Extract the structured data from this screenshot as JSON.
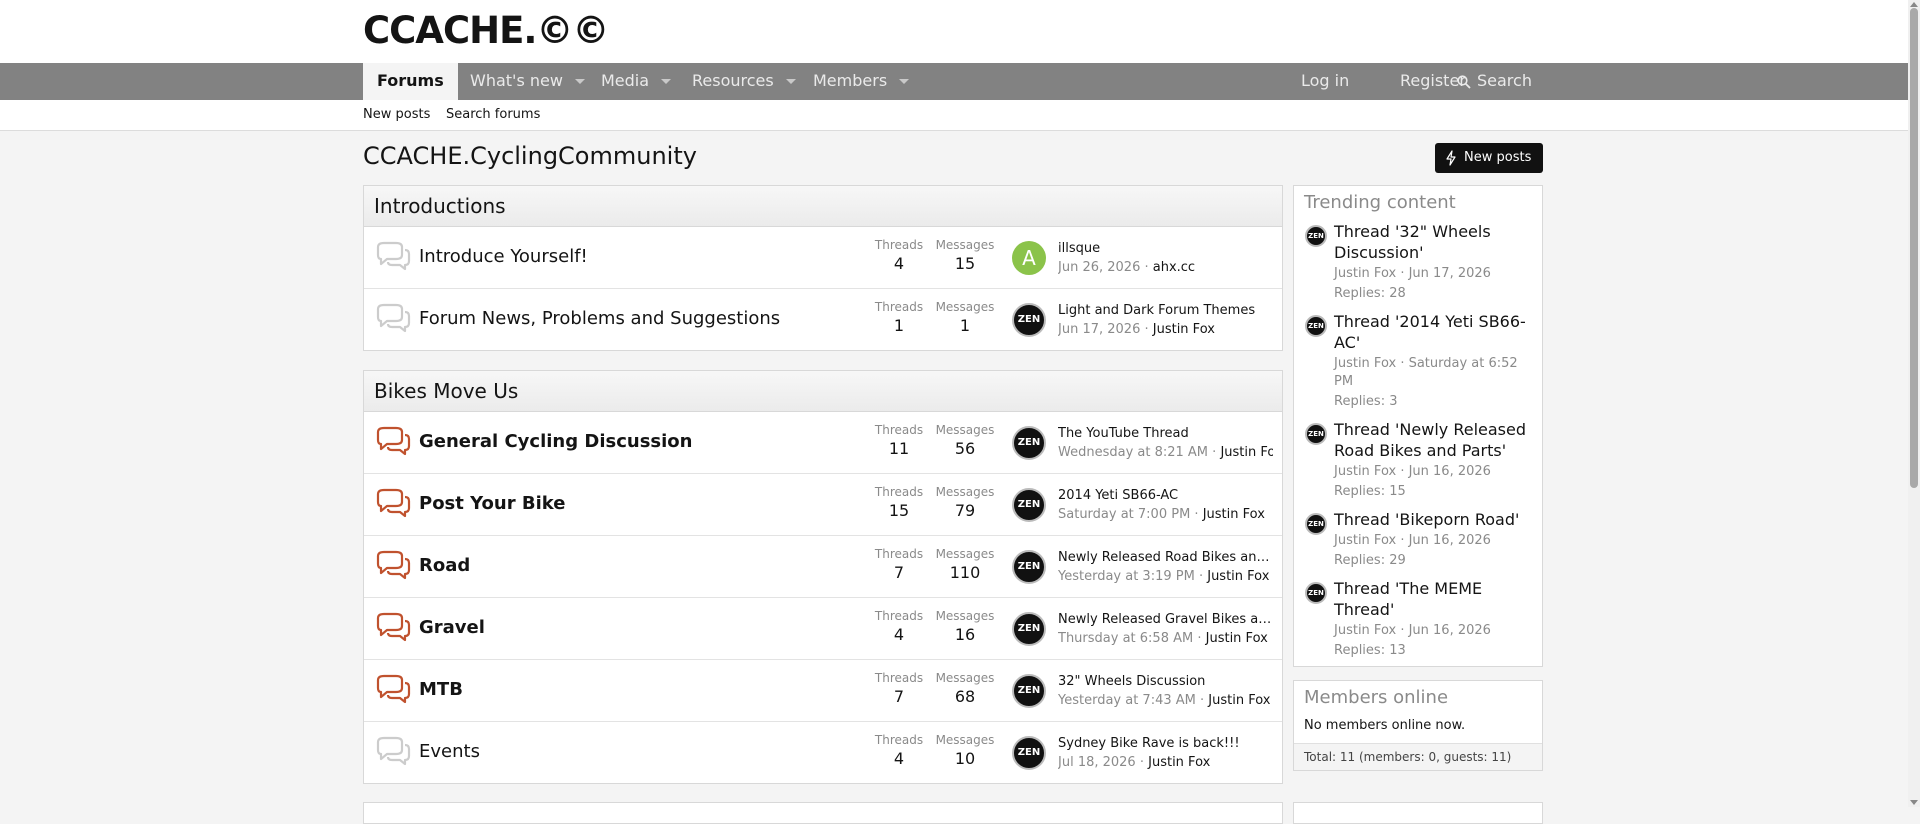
{
  "logo": "CCACHE.©©",
  "nav": {
    "forums": "Forums",
    "whats_new": "What's new",
    "media": "Media",
    "resources": "Resources",
    "members": "Members",
    "login": "Log in",
    "register": "Register",
    "search": "Search"
  },
  "subnav": {
    "new_posts": "New posts",
    "search_forums": "Search forums"
  },
  "page_title": "CCACHE.CyclingCommunity",
  "new_posts_button": "New posts",
  "labels": {
    "threads": "Threads",
    "messages": "Messages"
  },
  "categories": [
    {
      "title": "Introductions",
      "nodes": [
        {
          "title": "Introduce Yourself!",
          "threads": "4",
          "messages": "15",
          "avatar": "A",
          "latest_title": "illsque",
          "latest_date": "Jun 26, 2026",
          "latest_user": "ahx.cc"
        },
        {
          "title": "Forum News, Problems and Suggestions",
          "threads": "1",
          "messages": "1",
          "avatar": "ZEN",
          "latest_title": "Light and Dark Forum Themes",
          "latest_date": "Jun 17, 2026",
          "latest_user": "Justin Fox"
        }
      ]
    },
    {
      "title": "Bikes Move Us",
      "nodes": [
        {
          "title": "General Cycling Discussion",
          "threads": "11",
          "messages": "56",
          "avatar": "ZEN",
          "latest_title": "The YouTube Thread",
          "latest_date": "Wednesday at 8:21 AM",
          "latest_user": "Justin Fox"
        },
        {
          "title": "Post Your Bike",
          "threads": "15",
          "messages": "79",
          "avatar": "ZEN",
          "latest_title": "2014 Yeti SB66-AC",
          "latest_date": "Saturday at 7:00 PM",
          "latest_user": "Justin Fox"
        },
        {
          "title": "Road",
          "threads": "7",
          "messages": "110",
          "avatar": "ZEN",
          "latest_title": "Newly Released Road Bikes and Parts",
          "latest_date": "Yesterday at 3:19 PM",
          "latest_user": "Justin Fox"
        },
        {
          "title": "Gravel",
          "threads": "4",
          "messages": "16",
          "avatar": "ZEN",
          "latest_title": "Newly Released Gravel Bikes and Parts",
          "latest_date": "Thursday at 6:58 AM",
          "latest_user": "Justin Fox"
        },
        {
          "title": "MTB",
          "threads": "7",
          "messages": "68",
          "avatar": "ZEN",
          "latest_title": "32\" Wheels Discussion",
          "latest_date": "Yesterday at 7:43 AM",
          "latest_user": "Justin Fox"
        },
        {
          "title": "Events",
          "threads": "4",
          "messages": "10",
          "avatar": "ZEN",
          "latest_title": "Sydney Bike Rave is back!!!",
          "latest_date": "Jul 18, 2026",
          "latest_user": "Justin Fox"
        }
      ]
    }
  ],
  "trending": {
    "title": "Trending content",
    "items": [
      {
        "title": "Thread '32\" Wheels Discussion'",
        "meta": "Justin Fox · Jun 17, 2026",
        "replies": "Replies: 28"
      },
      {
        "title": "Thread '2014 Yeti SB66-AC'",
        "meta": "Justin Fox · Saturday at 6:52 PM",
        "replies": "Replies: 3"
      },
      {
        "title": "Thread 'Newly Released Road Bikes and Parts'",
        "meta": "Justin Fox · Jun 16, 2026",
        "replies": "Replies: 15"
      },
      {
        "title": "Thread 'Bikeporn Road'",
        "meta": "Justin Fox · Jun 16, 2026",
        "replies": "Replies: 29"
      },
      {
        "title": "Thread 'The MEME Thread'",
        "meta": "Justin Fox · Jun 16, 2026",
        "replies": "Replies: 13"
      }
    ]
  },
  "members_online": {
    "title": "Members online",
    "text": "No members online now.",
    "total": "Total: 11 (members: 0, guests: 11)"
  },
  "colors": {
    "navbar": "#828282",
    "unread_icon": "#c0522e",
    "read_icon": "#cccccc",
    "avatar_green": "#8bc34a"
  }
}
